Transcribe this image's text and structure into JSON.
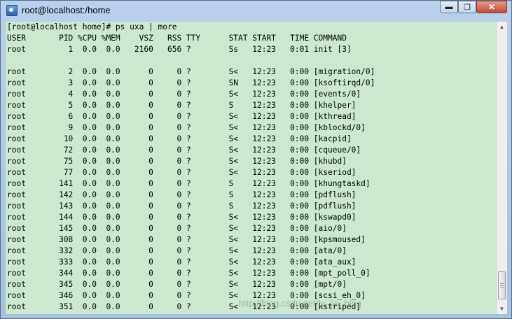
{
  "window": {
    "title": "root@localhost:/home",
    "minimize_symbol": "▬",
    "restore_symbol": "❐",
    "close_symbol": "✕"
  },
  "terminal": {
    "lines": [
      "[root@localhost home]# ps uxa | more",
      "USER       PID %CPU %MEM    VSZ   RSS TTY      STAT START   TIME COMMAND",
      "root         1  0.0  0.0   2160   656 ?        Ss   12:23   0:01 init [3]",
      "",
      "root         2  0.0  0.0      0     0 ?        S<   12:23   0:00 [migration/0]",
      "root         3  0.0  0.0      0     0 ?        SN   12:23   0:00 [ksoftirqd/0]",
      "root         4  0.0  0.0      0     0 ?        S<   12:23   0:00 [events/0]",
      "root         5  0.0  0.0      0     0 ?        S    12:23   0:00 [khelper]",
      "root         6  0.0  0.0      0     0 ?        S<   12:23   0:00 [kthread]",
      "root         9  0.0  0.0      0     0 ?        S<   12:23   0:00 [kblockd/0]",
      "root        10  0.0  0.0      0     0 ?        S<   12:23   0:00 [kacpid]",
      "root        72  0.0  0.0      0     0 ?        S<   12:23   0:00 [cqueue/0]",
      "root        75  0.0  0.0      0     0 ?        S<   12:23   0:00 [khubd]",
      "root        77  0.0  0.0      0     0 ?        S<   12:23   0:00 [kseriod]",
      "root       141  0.0  0.0      0     0 ?        S    12:23   0:00 [khungtaskd]",
      "root       142  0.0  0.0      0     0 ?        S    12:23   0:00 [pdflush]",
      "root       143  0.0  0.0      0     0 ?        S    12:23   0:00 [pdflush]",
      "root       144  0.0  0.0      0     0 ?        S<   12:23   0:00 [kswapd0]",
      "root       145  0.0  0.0      0     0 ?        S<   12:23   0:00 [aio/0]",
      "root       308  0.0  0.0      0     0 ?        S<   12:23   0:00 [kpsmoused]",
      "root       332  0.0  0.0      0     0 ?        S<   12:23   0:00 [ata/0]",
      "root       333  0.0  0.0      0     0 ?        S<   12:23   0:00 [ata_aux]",
      "root       344  0.0  0.0      0     0 ?        S<   12:23   0:00 [mpt_poll_0]",
      "root       345  0.0  0.0      0     0 ?        S<   12:23   0:00 [mpt/0]",
      "root       346  0.0  0.0      0     0 ?        S<   12:23   0:00 [scsi_eh_0]",
      "root       351  0.0  0.0      0     0 ?        S<   12:23   0:00 [kstriped]"
    ]
  },
  "watermark": "http://blog.csdn.net/ly_jie_blog",
  "colors": {
    "terminal_bg": "#cce8cf",
    "terminal_fg": "#000000",
    "title_bar": "#b9d1ea",
    "close_button": "#c04b37"
  }
}
